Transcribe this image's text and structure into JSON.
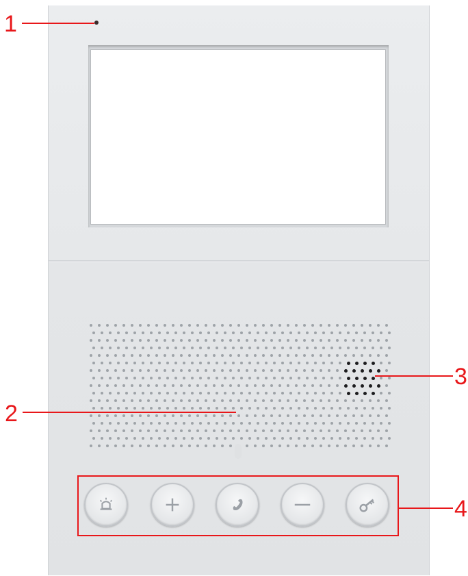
{
  "diagram": {
    "callouts": [
      {
        "id": "1",
        "label": "1",
        "target": "mic-hole"
      },
      {
        "id": "2",
        "label": "2",
        "target": "speaker-grille"
      },
      {
        "id": "3",
        "label": "3",
        "target": "speaker-dark-holes"
      },
      {
        "id": "4",
        "label": "4",
        "target": "button-row"
      }
    ],
    "buttons": [
      {
        "name": "alarm-button",
        "icon": "alarm-light-icon"
      },
      {
        "name": "plus-button",
        "icon": "plus-icon"
      },
      {
        "name": "call-button",
        "icon": "phone-handset-icon"
      },
      {
        "name": "minus-button",
        "icon": "minus-icon"
      },
      {
        "name": "unlock-button",
        "icon": "key-icon"
      }
    ],
    "colors": {
      "annotation": "#e8171a",
      "device_body": "#e6e8ea",
      "screen": "#ffffff",
      "icon": "#9ba0a6"
    }
  }
}
